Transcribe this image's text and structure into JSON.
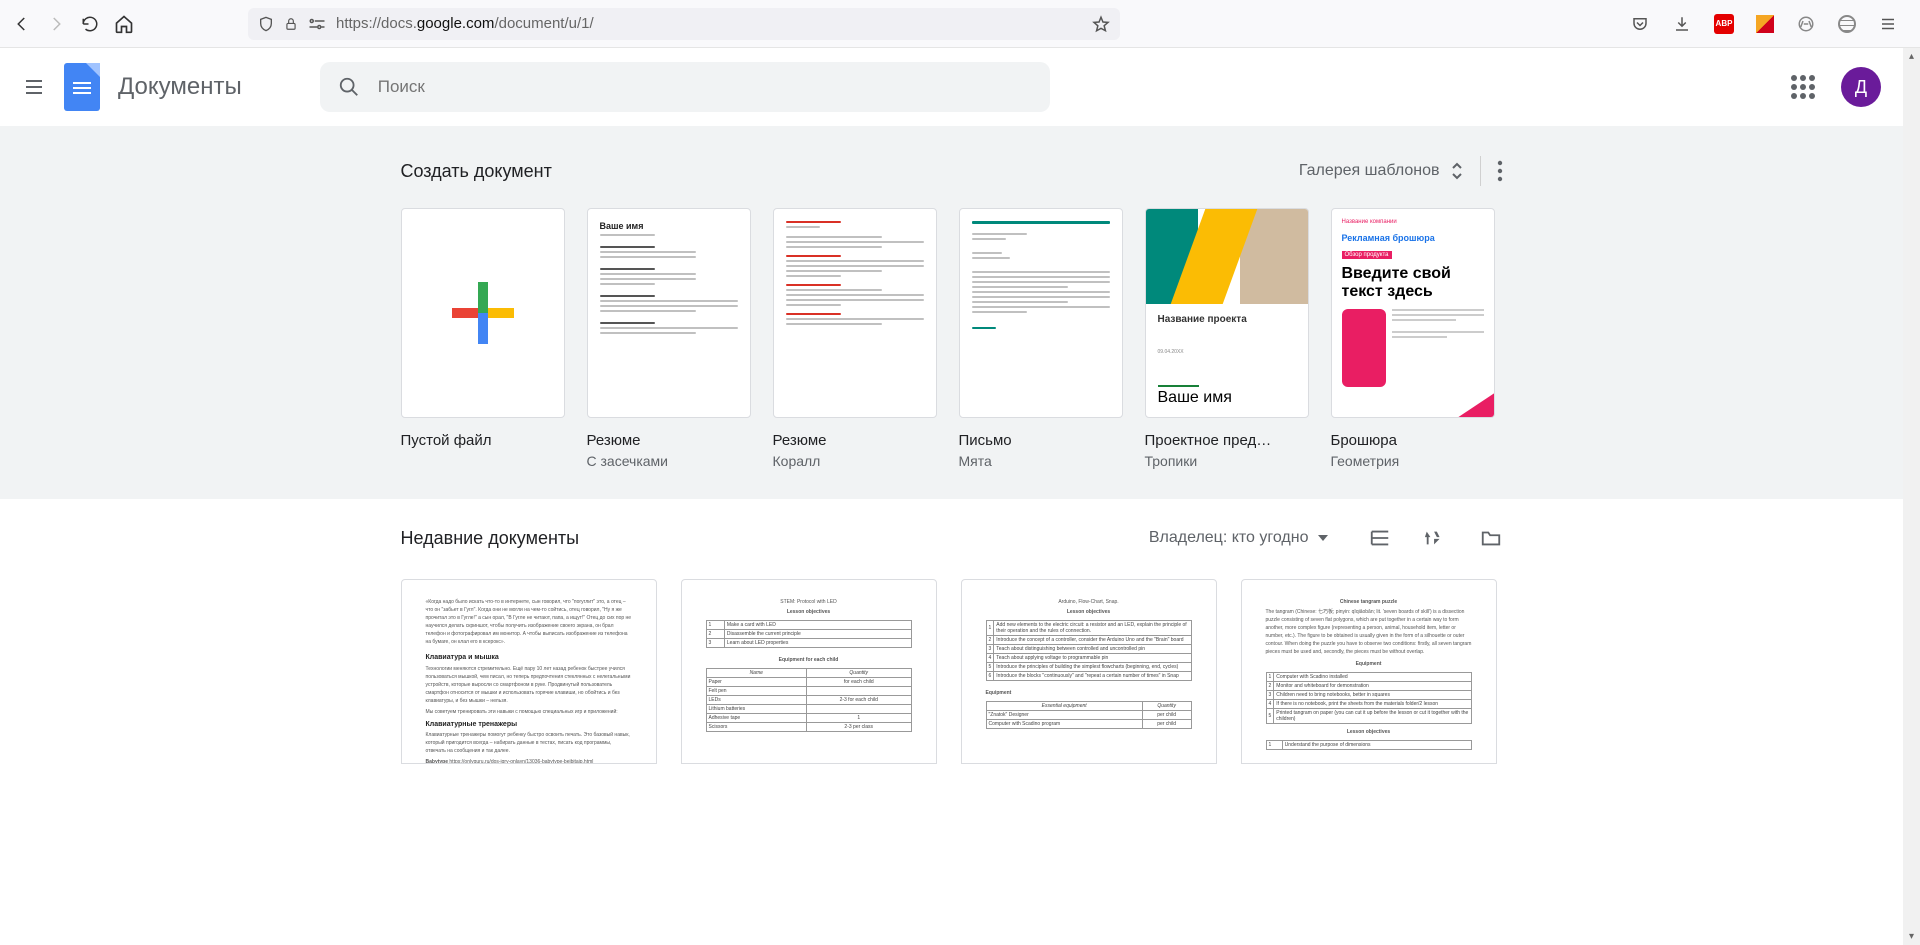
{
  "browser": {
    "url_prefix": "https://docs.",
    "url_domain": "google.com",
    "url_suffix": "/document/u/1/"
  },
  "header": {
    "app_title": "Документы",
    "search_placeholder": "Поиск",
    "avatar_letter": "Д"
  },
  "templates": {
    "heading": "Создать документ",
    "gallery_label": "Галерея шаблонов",
    "items": [
      {
        "title": "Пустой файл",
        "subtitle": ""
      },
      {
        "title": "Резюме",
        "subtitle": "С засечками"
      },
      {
        "title": "Резюме",
        "subtitle": "Коралл"
      },
      {
        "title": "Письмо",
        "subtitle": "Мята"
      },
      {
        "title": "Проектное пред…",
        "subtitle": "Тропики"
      },
      {
        "title": "Брошюра",
        "subtitle": "Геометрия"
      }
    ],
    "thumb_text": {
      "resume_name": "Ваше имя",
      "project_title": "Название проекта",
      "brochure_company": "Название компании",
      "brochure_title": "Рекламная брошюра",
      "brochure_section": "Обзор продукта",
      "brochure_cta": "Введите свой текст здесь"
    }
  },
  "recent": {
    "heading": "Недавние документы",
    "owner_label": "Владелец: кто угодно",
    "docs": {
      "d1_title": "Клавиатура и мышка",
      "d1_sub": "Клавиатурные тренажеры",
      "d2_h1": "STEM: Protocol with LED",
      "d2_h2": "Lesson objectives",
      "d2_h3": "Equipment for each child",
      "d2_r1a": "Make a card with LED",
      "d2_r2a": "Disassemble the current principle",
      "d2_r3a": "Learn about LED properties",
      "d2_nm": "Name",
      "d2_qt": "Quantity",
      "d2_paper": "Paper",
      "d2_paper_q": "for each child",
      "d2_pin": "Felt pen",
      "d2_led": "LEDs",
      "d2_led_q": "2-3 for each child",
      "d2_bat": "Lithium batteries",
      "d2_tape": "Adhesive tape",
      "d2_sci": "Scissors",
      "d2_sci_q": "2-3 per class",
      "d3_h1": "Arduino, Flow-Chart, Snap.",
      "d3_h2": "Lesson objectives",
      "d3_h3": "Equipment",
      "d3_r1": "Add new elements to the electric circuit: a resistor and an LED, explain the principle of their operation and the rules of connection.",
      "d3_r2": "Introduce the concept of a controller, consider the Arduino Uno and the \"Brain\" board",
      "d3_r3": "Teach about distinguishing between controlled and uncontrolled pin",
      "d3_r4": "Teach about applying voltage to programmable pin",
      "d3_r5": "Introduce the principles of building the simplest flowcharts (beginning, end, cycles)",
      "d3_r6": "Introduce the blocks \"continuously\" and \"repeat a certain number of times\" in Snap",
      "d3_eq": "Essential equipment",
      "d3_eqq": "Quantity",
      "d3_e1": "\"Znatok\" Designer",
      "d3_e1q": "per child",
      "d4_h1": "Chinese tangram puzzle",
      "d4_intro": "The tangram (Chinese: 七巧板; pinyin: qīqiǎobǎn; lit. 'seven boards of skill') is a dissection puzzle consisting of seven flat polygons, which are put together in a certain way to form another, more complex figure (representing a person, animal, household item, letter or number, etc.). The figure to be obtained is usually given in the form of a silhouette or outer contour. When doing the puzzle you have to observe two conditions: firstly, all seven tangram pieces must be used and, secondly, the pieces must be without overlap.",
      "d4_h2": "Equipment",
      "d4_e1": "Computer with Scadino installed",
      "d4_e2": "Monitor and whiteboard for demonstration",
      "d4_e3": "Children need to bring notebooks, better in squares",
      "d4_e4": "If there is no notebook, print the sheets from the materials folder/2 lesson",
      "d4_e5": "Printed tangram on paper (you can cut it up before the lesson or cut it together with the children)",
      "d4_h3": "Lesson objectives",
      "d4_o1": "Understand the purpose of dimensions"
    }
  }
}
